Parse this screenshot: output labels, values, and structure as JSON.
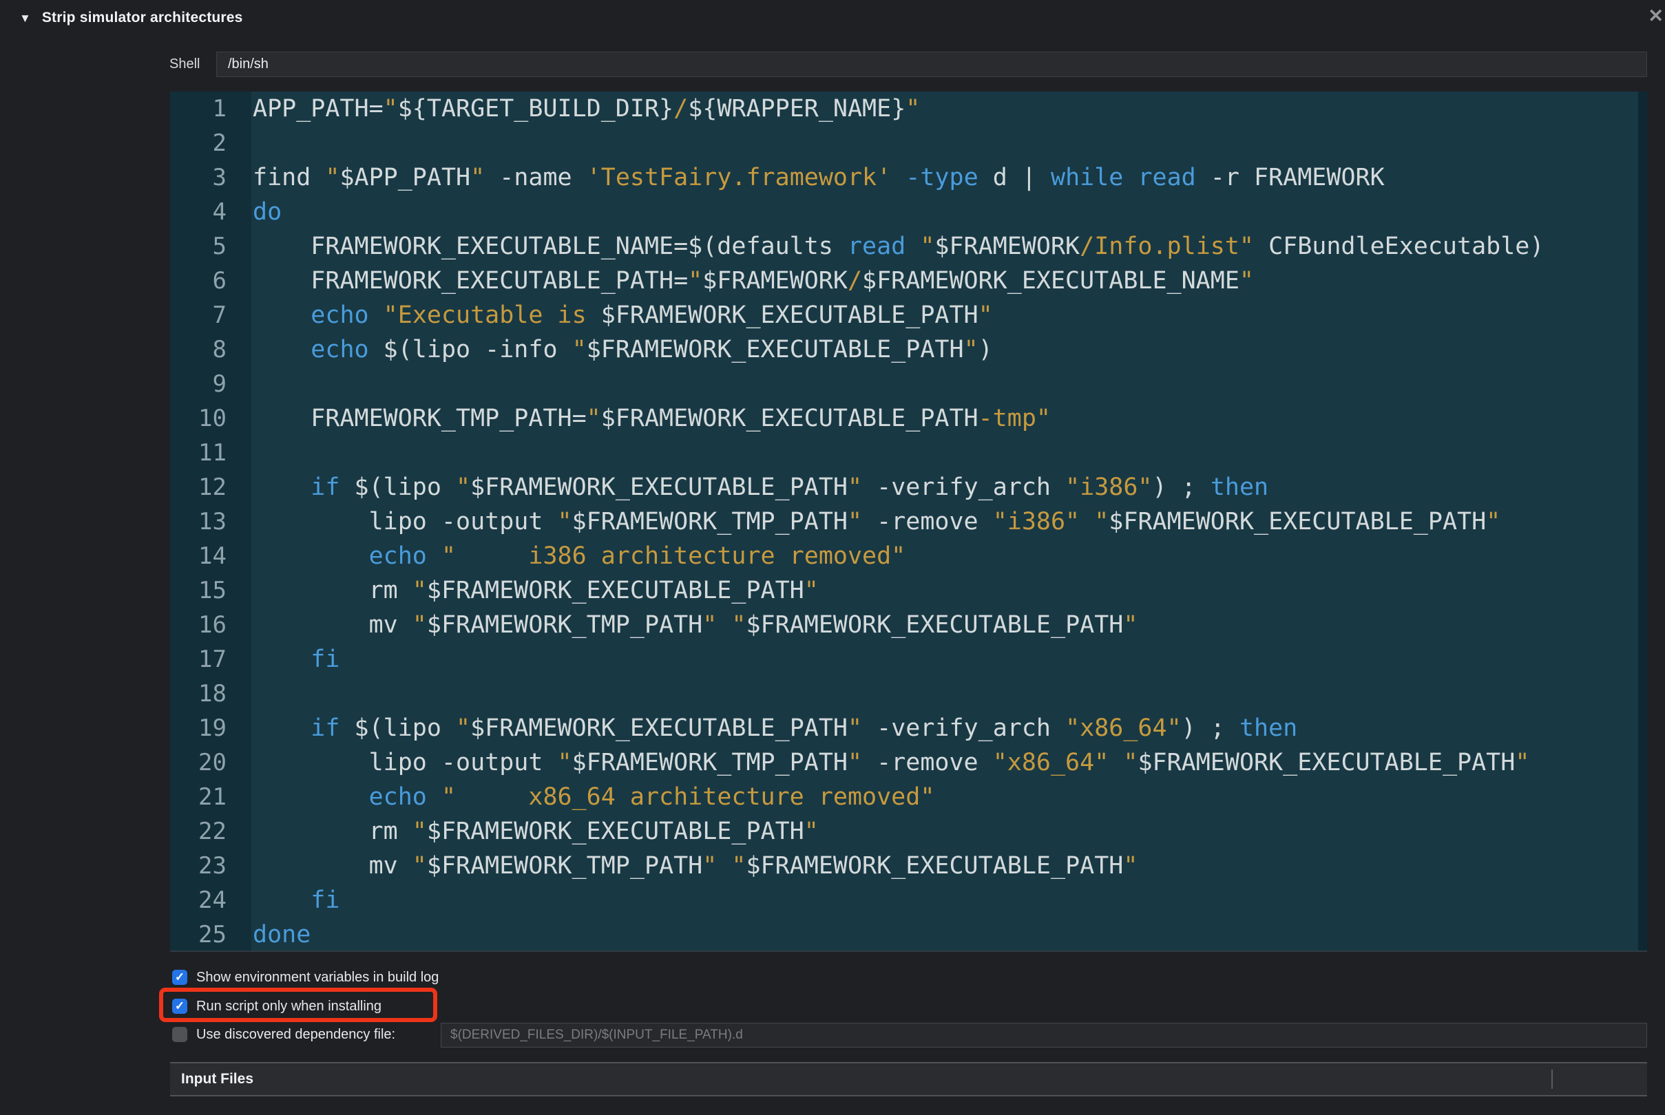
{
  "icons": {
    "disclosure": "▼",
    "close": "✕",
    "check": "✓"
  },
  "header": {
    "title": "Strip simulator architectures"
  },
  "shell": {
    "label": "Shell",
    "value": "/bin/sh"
  },
  "editor": {
    "lines": [
      {
        "n": "1",
        "seg": [
          [
            "p",
            "APP_PATH="
          ],
          [
            "s",
            "\""
          ],
          [
            "p",
            "${TARGET_BUILD_DIR}"
          ],
          [
            "s",
            "/"
          ],
          [
            "p",
            "${WRAPPER_NAME}"
          ],
          [
            "s",
            "\""
          ]
        ]
      },
      {
        "n": "2",
        "seg": []
      },
      {
        "n": "3",
        "seg": [
          [
            "p",
            "find "
          ],
          [
            "s",
            "\""
          ],
          [
            "p",
            "$APP_PATH"
          ],
          [
            "s",
            "\""
          ],
          [
            "p",
            " -name "
          ],
          [
            "s",
            "'TestFairy.framework'"
          ],
          [
            "p",
            " "
          ],
          [
            "k",
            "-type"
          ],
          [
            "p",
            " d | "
          ],
          [
            "k",
            "while"
          ],
          [
            "p",
            " "
          ],
          [
            "k",
            "read"
          ],
          [
            "p",
            " -r FRAMEWORK"
          ]
        ]
      },
      {
        "n": "4",
        "seg": [
          [
            "k",
            "do"
          ]
        ]
      },
      {
        "n": "5",
        "seg": [
          [
            "p",
            "    FRAMEWORK_EXECUTABLE_NAME=$(defaults "
          ],
          [
            "k",
            "read"
          ],
          [
            "p",
            " "
          ],
          [
            "s",
            "\""
          ],
          [
            "p",
            "$FRAMEWORK"
          ],
          [
            "s",
            "/Info.plist\""
          ],
          [
            "p",
            " CFBundleExecutable)"
          ]
        ]
      },
      {
        "n": "6",
        "seg": [
          [
            "p",
            "    FRAMEWORK_EXECUTABLE_PATH="
          ],
          [
            "s",
            "\""
          ],
          [
            "p",
            "$FRAMEWORK"
          ],
          [
            "s",
            "/"
          ],
          [
            "p",
            "$FRAMEWORK_EXECUTABLE_NAME"
          ],
          [
            "s",
            "\""
          ]
        ]
      },
      {
        "n": "7",
        "seg": [
          [
            "p",
            "    "
          ],
          [
            "k",
            "echo"
          ],
          [
            "p",
            " "
          ],
          [
            "s",
            "\"Executable is "
          ],
          [
            "p",
            "$FRAMEWORK_EXECUTABLE_PATH"
          ],
          [
            "s",
            "\""
          ]
        ]
      },
      {
        "n": "8",
        "seg": [
          [
            "p",
            "    "
          ],
          [
            "k",
            "echo"
          ],
          [
            "p",
            " $(lipo -info "
          ],
          [
            "s",
            "\""
          ],
          [
            "p",
            "$FRAMEWORK_EXECUTABLE_PATH"
          ],
          [
            "s",
            "\""
          ],
          [
            "p",
            ")"
          ]
        ]
      },
      {
        "n": "9",
        "seg": []
      },
      {
        "n": "10",
        "seg": [
          [
            "p",
            "    FRAMEWORK_TMP_PATH="
          ],
          [
            "s",
            "\""
          ],
          [
            "p",
            "$FRAMEWORK_EXECUTABLE_PATH"
          ],
          [
            "s",
            "-tmp\""
          ]
        ]
      },
      {
        "n": "11",
        "seg": []
      },
      {
        "n": "12",
        "seg": [
          [
            "p",
            "    "
          ],
          [
            "k",
            "if"
          ],
          [
            "p",
            " $(lipo "
          ],
          [
            "s",
            "\""
          ],
          [
            "p",
            "$FRAMEWORK_EXECUTABLE_PATH"
          ],
          [
            "s",
            "\""
          ],
          [
            "p",
            " -verify_arch "
          ],
          [
            "s",
            "\"i386\""
          ],
          [
            "p",
            ") ; "
          ],
          [
            "k",
            "then"
          ]
        ]
      },
      {
        "n": "13",
        "seg": [
          [
            "p",
            "        lipo -output "
          ],
          [
            "s",
            "\""
          ],
          [
            "p",
            "$FRAMEWORK_TMP_PATH"
          ],
          [
            "s",
            "\""
          ],
          [
            "p",
            " -remove "
          ],
          [
            "s",
            "\"i386\""
          ],
          [
            "p",
            " "
          ],
          [
            "s",
            "\""
          ],
          [
            "p",
            "$FRAMEWORK_EXECUTABLE_PATH"
          ],
          [
            "s",
            "\""
          ]
        ]
      },
      {
        "n": "14",
        "seg": [
          [
            "p",
            "        "
          ],
          [
            "k",
            "echo"
          ],
          [
            "p",
            " "
          ],
          [
            "s",
            "\"     i386 architecture removed\""
          ]
        ]
      },
      {
        "n": "15",
        "seg": [
          [
            "p",
            "        rm "
          ],
          [
            "s",
            "\""
          ],
          [
            "p",
            "$FRAMEWORK_EXECUTABLE_PATH"
          ],
          [
            "s",
            "\""
          ]
        ]
      },
      {
        "n": "16",
        "seg": [
          [
            "p",
            "        mv "
          ],
          [
            "s",
            "\""
          ],
          [
            "p",
            "$FRAMEWORK_TMP_PATH"
          ],
          [
            "s",
            "\""
          ],
          [
            "p",
            " "
          ],
          [
            "s",
            "\""
          ],
          [
            "p",
            "$FRAMEWORK_EXECUTABLE_PATH"
          ],
          [
            "s",
            "\""
          ]
        ]
      },
      {
        "n": "17",
        "seg": [
          [
            "p",
            "    "
          ],
          [
            "k",
            "fi"
          ]
        ]
      },
      {
        "n": "18",
        "seg": []
      },
      {
        "n": "19",
        "seg": [
          [
            "p",
            "    "
          ],
          [
            "k",
            "if"
          ],
          [
            "p",
            " $(lipo "
          ],
          [
            "s",
            "\""
          ],
          [
            "p",
            "$FRAMEWORK_EXECUTABLE_PATH"
          ],
          [
            "s",
            "\""
          ],
          [
            "p",
            " -verify_arch "
          ],
          [
            "s",
            "\"x86_64\""
          ],
          [
            "p",
            ") ; "
          ],
          [
            "k",
            "then"
          ]
        ]
      },
      {
        "n": "20",
        "seg": [
          [
            "p",
            "        lipo -output "
          ],
          [
            "s",
            "\""
          ],
          [
            "p",
            "$FRAMEWORK_TMP_PATH"
          ],
          [
            "s",
            "\""
          ],
          [
            "p",
            " -remove "
          ],
          [
            "s",
            "\"x86_64\""
          ],
          [
            "p",
            " "
          ],
          [
            "s",
            "\""
          ],
          [
            "p",
            "$FRAMEWORK_EXECUTABLE_PATH"
          ],
          [
            "s",
            "\""
          ]
        ]
      },
      {
        "n": "21",
        "seg": [
          [
            "p",
            "        "
          ],
          [
            "k",
            "echo"
          ],
          [
            "p",
            " "
          ],
          [
            "s",
            "\"     x86_64 architecture removed\""
          ]
        ]
      },
      {
        "n": "22",
        "seg": [
          [
            "p",
            "        rm "
          ],
          [
            "s",
            "\""
          ],
          [
            "p",
            "$FRAMEWORK_EXECUTABLE_PATH"
          ],
          [
            "s",
            "\""
          ]
        ]
      },
      {
        "n": "23",
        "seg": [
          [
            "p",
            "        mv "
          ],
          [
            "s",
            "\""
          ],
          [
            "p",
            "$FRAMEWORK_TMP_PATH"
          ],
          [
            "s",
            "\""
          ],
          [
            "p",
            " "
          ],
          [
            "s",
            "\""
          ],
          [
            "p",
            "$FRAMEWORK_EXECUTABLE_PATH"
          ],
          [
            "s",
            "\""
          ]
        ]
      },
      {
        "n": "24",
        "seg": [
          [
            "p",
            "    "
          ],
          [
            "k",
            "fi"
          ]
        ]
      },
      {
        "n": "25",
        "seg": [
          [
            "k",
            "done"
          ]
        ]
      }
    ]
  },
  "options": [
    {
      "label": "Show environment variables in build log",
      "checked": true
    },
    {
      "label": "Run script only when installing",
      "checked": true,
      "annotated": true
    },
    {
      "label": "Use discovered dependency file:",
      "checked": false,
      "placeholder": "$(DERIVED_FILES_DIR)/$(INPUT_FILE_PATH).d"
    }
  ],
  "sections": {
    "input_files": "Input Files"
  },
  "colors": {
    "page_bg": "#1f2024",
    "editor_bg": "#183844",
    "gutter_bg": "#122e39",
    "code_plain": "#d4dadb",
    "code_string": "#c79a3e",
    "code_keyword": "#4a9cdb",
    "line_number": "#8ea3ab",
    "checkbox_accent": "#2474e8",
    "annotation_red": "#ee3419"
  }
}
